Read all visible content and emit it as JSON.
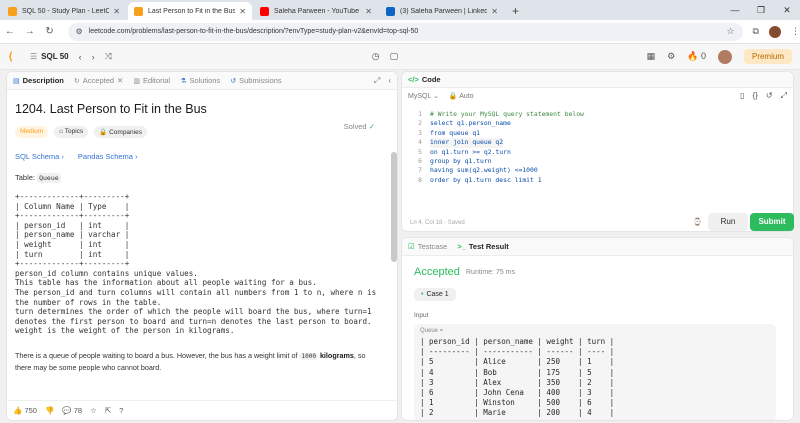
{
  "browser": {
    "tabs": [
      {
        "title": "SQL 50 - Study Plan - LeetCode",
        "color": "#f89f1b",
        "active": false
      },
      {
        "title": "Last Person to Fit in the Bus - L",
        "color": "#f89f1b",
        "active": true
      },
      {
        "title": "Saleha Parween - YouTube",
        "color": "#ff0000",
        "active": false
      },
      {
        "title": "(3) Saleha Parween | LinkedIn",
        "color": "#0a66c2",
        "active": false
      }
    ],
    "url": "leetcode.com/problems/last-person-to-fit-in-the-bus/description/?envType=study-plan-v2&envId=top-sql-50"
  },
  "lc_nav": {
    "title": "SQL 50",
    "premium_label": "Premium",
    "fire_count": "0"
  },
  "left_tabs": [
    "Description",
    "Accepted",
    "Editorial",
    "Solutions",
    "Submissions"
  ],
  "problem": {
    "title": "1204. Last Person to Fit in the Bus",
    "status": "Solved",
    "difficulty": "Medium",
    "topics_label": "Topics",
    "companies_label": "Companies",
    "schema_links": [
      "SQL Schema",
      "Pandas Schema"
    ],
    "table_label": "Table:",
    "table_name": "Queue",
    "schema_text": "+-------------+---------+\n| Column Name | Type    |\n+-------------+---------+\n| person_id   | int     |\n| person_name | varchar |\n| weight      | int     |\n| turn        | int     |\n+-------------+---------+\nperson_id column contains unique values.\nThis table has the information about all people waiting for a bus.\nThe person_id and turn columns will contain all numbers from 1 to n, where n is\nthe number of rows in the table.\nturn determines the order of which the people will board the bus, where turn=1\ndenotes the first person to board and turn=n denotes the last person to board.\nweight is the weight of the person in kilograms.",
    "para_pre": "There is a queue of people waiting to board a bus. However, the bus has a weight limit of ",
    "para_code": "1000",
    "para_bold": "kilograms",
    "para_post": ", so there may be some people who cannot board.",
    "likes": "750",
    "comments": "78"
  },
  "editor": {
    "header": "Code",
    "language": "MySQL",
    "auto": "Auto",
    "lines": [
      "# Write your MySQL query statement below",
      "select q1.person_name",
      "from queue q1",
      "inner join queue q2",
      "on q1.turn >= q2.turn",
      "group by q1.turn",
      "having sum(q2.weight) <=1000",
      "order by q1.turn desc limit 1"
    ],
    "status_bar": "Ln 4, Col 18  ·  Saved",
    "run_label": "Run",
    "submit_label": "Submit"
  },
  "result": {
    "tab_testcase": "Testcase",
    "tab_result": "Test Result",
    "verdict": "Accepted",
    "runtime": "Runtime: 75 ms",
    "case_label": "Case 1",
    "input_label": "Input",
    "table_name": "Queue =",
    "table_text": "| person_id | person_name | weight | turn |\n| --------- | ----------- | ------ | ---- |\n| 5         | Alice       | 250    | 1    |\n| 4         | Bob         | 175    | 5    |\n| 3         | Alex        | 350    | 2    |\n| 6         | John Cena   | 400    | 3    |\n| 1         | Winston     | 500    | 6    |\n| 2         | Marie       | 200    | 4    |"
  }
}
